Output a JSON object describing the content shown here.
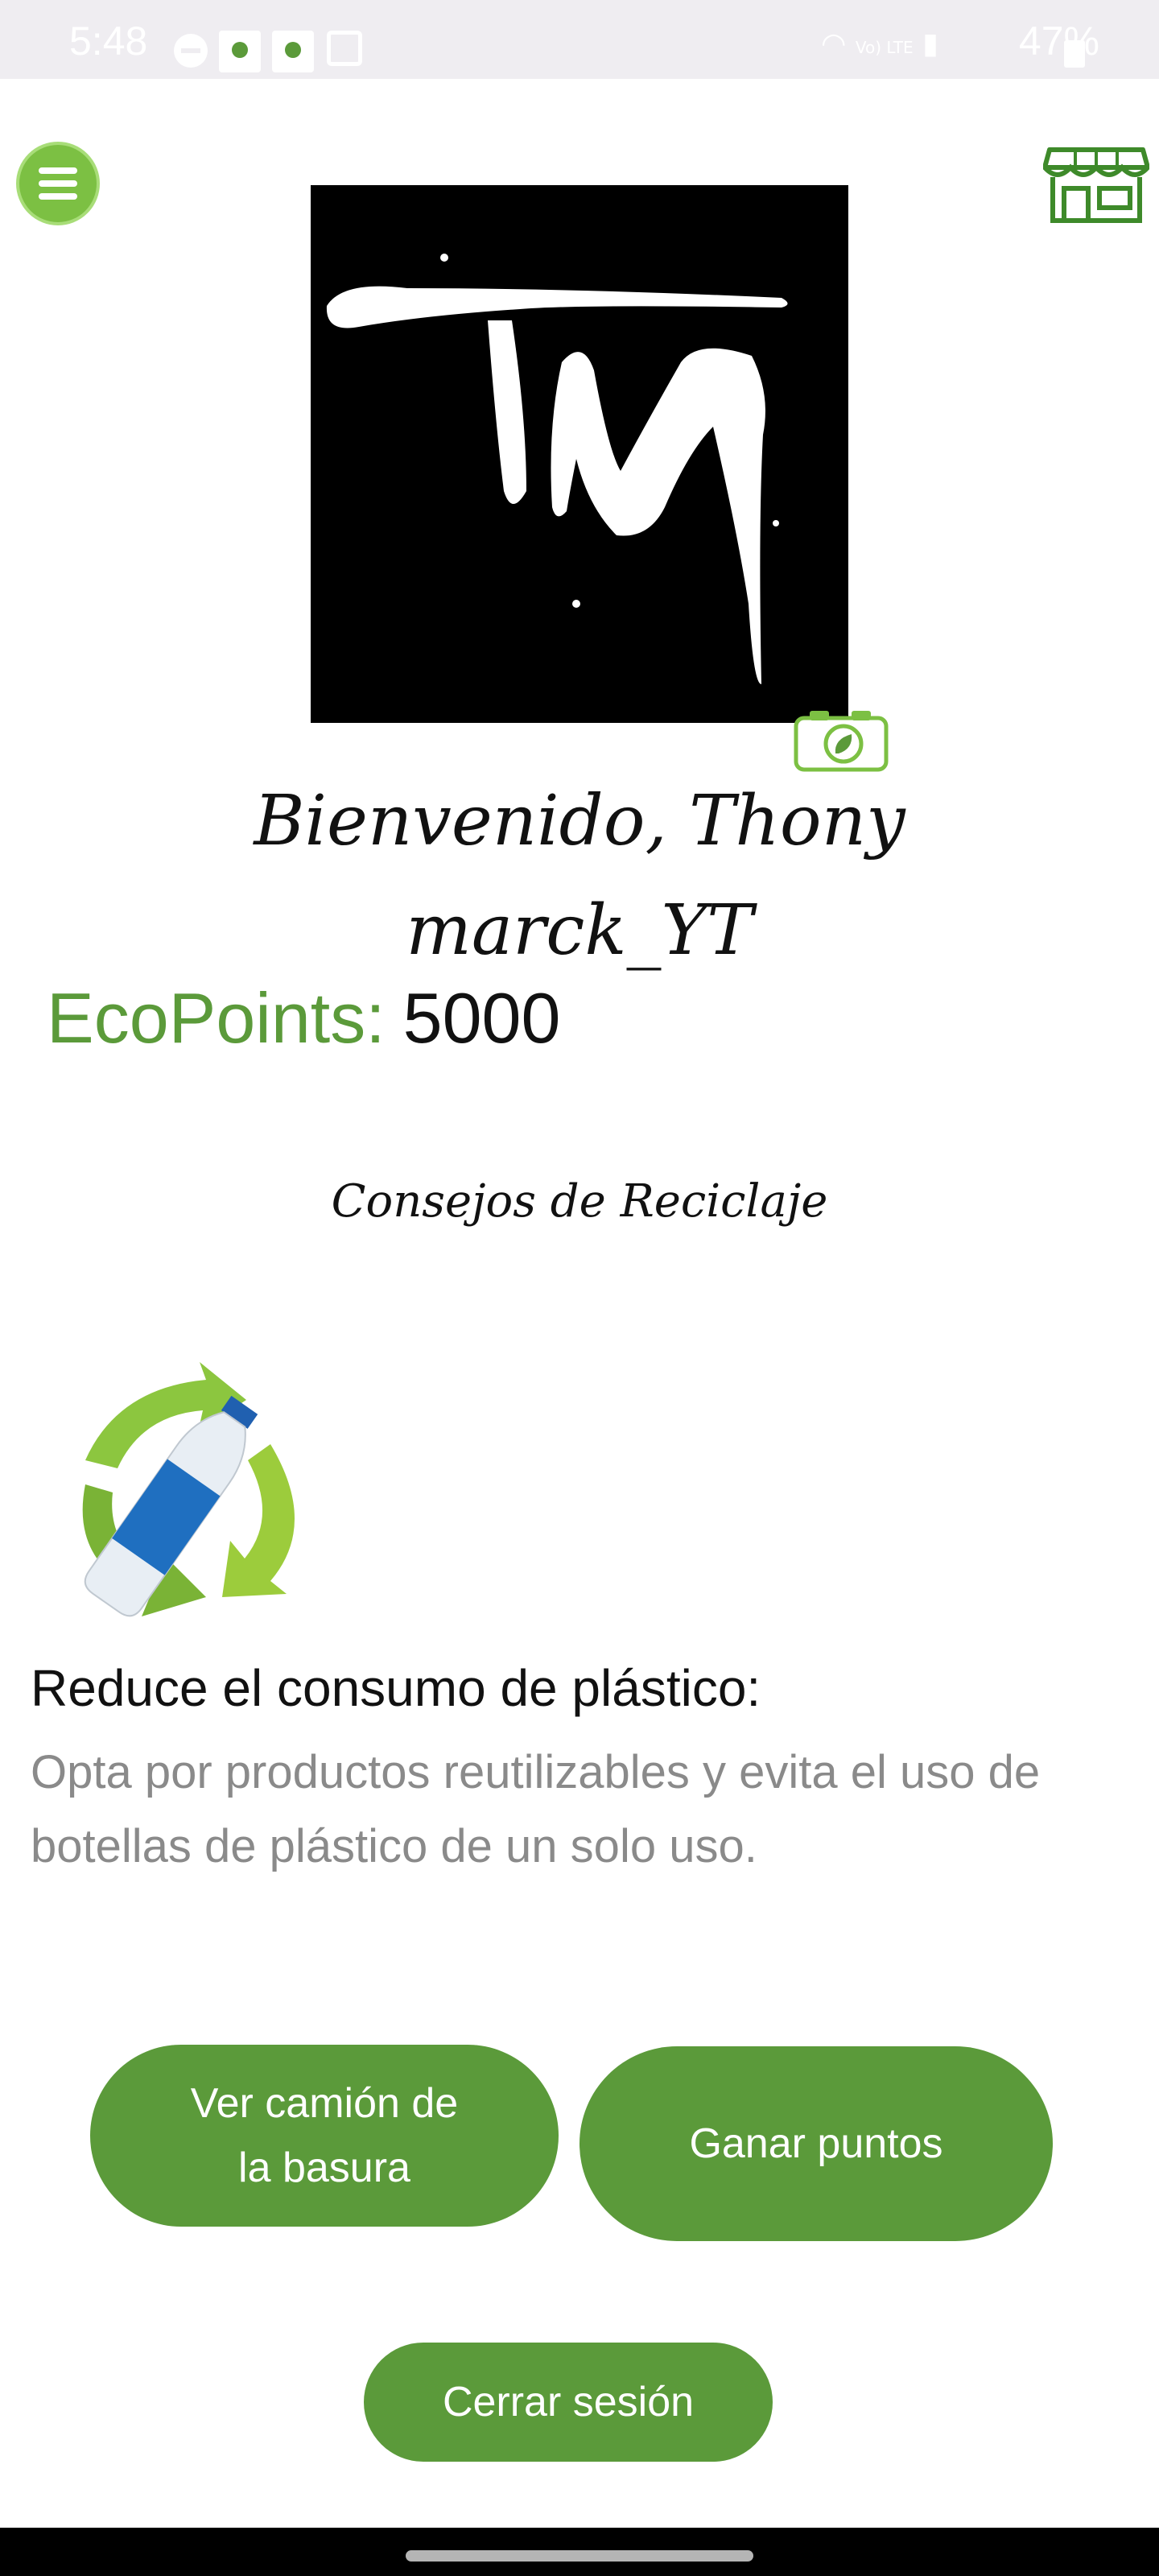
{
  "status_bar": {
    "time": "5:48",
    "network": "Vo) LTE",
    "battery": "47%"
  },
  "header": {
    "menu_icon": "hamburger-menu-icon",
    "store_icon": "store-icon"
  },
  "profile": {
    "avatar_text": "TM",
    "camera_icon": "camera-leaf-icon",
    "welcome_line1": "Bienvenido, Thony",
    "welcome_line2": "marck_YT",
    "ecopoints_label": "EcoPoints:",
    "ecopoints_value": "5000"
  },
  "tips": {
    "title": "Consejos de Reciclaje",
    "image_icon": "recycle-bottle-icon",
    "heading": "Reduce el consumo de plástico:",
    "body": "Opta por productos reutilizables y evita el uso de botellas de plástico de un solo uso."
  },
  "actions": {
    "truck_line1": "Ver camión de",
    "truck_line2": "la basura",
    "earn_points": "Ganar puntos",
    "logout": "Cerrar sesión"
  },
  "colors": {
    "accent": "#5b9a3a",
    "menu": "#7cc043",
    "secondary_text": "#8a8a8a"
  }
}
